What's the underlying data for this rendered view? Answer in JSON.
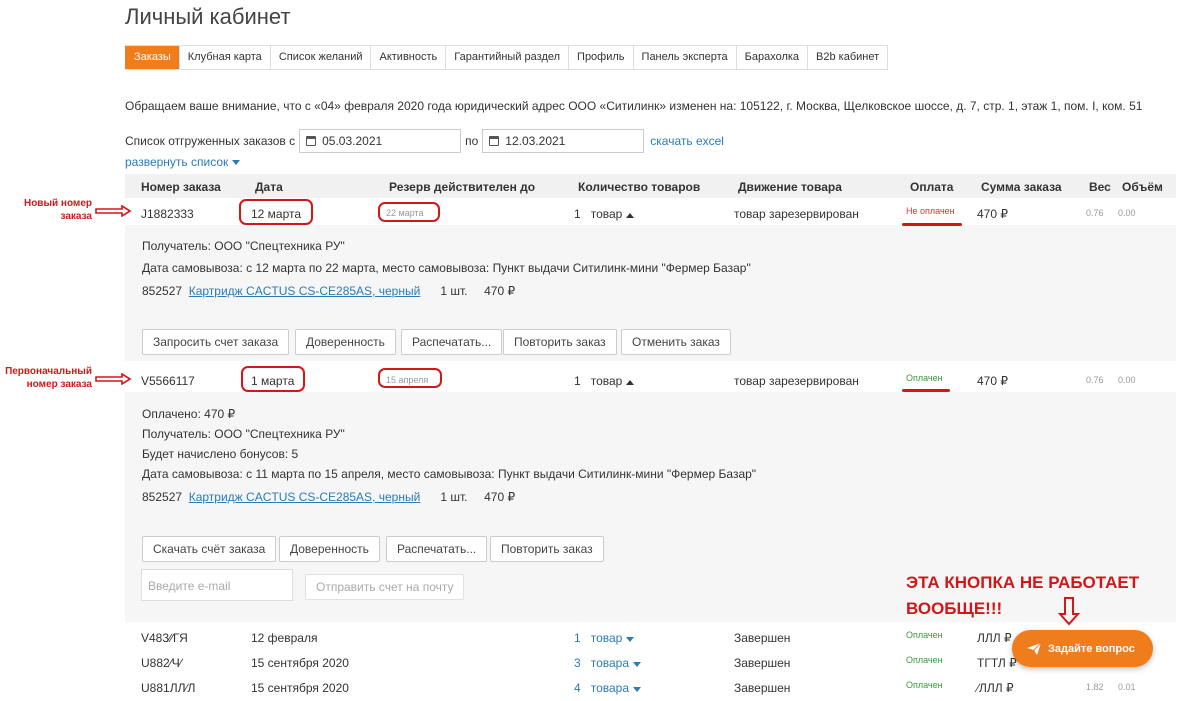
{
  "page": {
    "title": "Личный кабинет"
  },
  "tabs": [
    "Заказы",
    "Клубная карта",
    "Список желаний",
    "Активность",
    "Гарантийный раздел",
    "Профиль",
    "Панель эксперта",
    "Барахолка",
    "B2b кабинет"
  ],
  "notice": "Обращаем ваше внимание, что с «04» февраля 2020 года юридический адрес ООО «Ситилинк» изменен на: 105122, г. Москва, Щелковское шоссе, д. 7, стр. 1, этаж 1, пом. I, ком. 51",
  "filter": {
    "label": "Список отгруженных заказов с",
    "from": "05.03.2021",
    "to_label": "по",
    "to": "12.03.2021",
    "excel": "скачать excel",
    "expand": "развернуть список"
  },
  "columns": [
    "Номер заказа",
    "Дата",
    "Резерв действителен до",
    "Количество товаров",
    "Движение товара",
    "Оплата",
    "Сумма заказа",
    "Вес",
    "Объём"
  ],
  "order1": {
    "number": "J1882333",
    "date": "12 марта",
    "reserve": "22 марта",
    "qty": "1",
    "qty_unit": "товар",
    "movement": "товар зарезервирован",
    "payment": "Не оплачен",
    "sum": "470 ₽",
    "weight": "0.76",
    "volume": "0.00",
    "recipient": "Получатель: ООО \"Спецтехника РУ\"",
    "pickup": "Дата самовывоза: с 12 марта по 22 марта, место самовывоза: Пункт выдачи Ситилинк-мини \"Фермер Базар\"",
    "item_code": "852527",
    "item_name": "Картридж CACTUS CS-CE285AS, черный",
    "item_qty": "1 шт.",
    "item_price": "470 ₽",
    "buttons": [
      "Запросить счет заказа",
      "Доверенность",
      "Распечатать...",
      "Повторить заказ",
      "Отменить заказ"
    ]
  },
  "order2": {
    "number": "V5566117",
    "date": "1 марта",
    "reserve": "15 апреля",
    "qty": "1",
    "qty_unit": "товар",
    "movement": "товар зарезервирован",
    "payment": "Оплачен",
    "sum": "470 ₽",
    "weight": "0.76",
    "volume": "0.00",
    "paid": "Оплачено:  470 ₽",
    "recipient": "Получатель: ООО \"Спецтехника РУ\"",
    "bonus": "Будет начислено бонусов: 5",
    "pickup": "Дата самовывоза: с 11 марта по 15 апреля, место самовывоза: Пункт выдачи Ситилинк-мини \"Фермер Базар\"",
    "item_code": "852527",
    "item_name": "Картридж CACTUS CS-CE285AS, черный",
    "item_qty": "1 шт.",
    "item_price": "470 ₽",
    "buttons": [
      "Скачать счёт заказа",
      "Доверенность",
      "Распечатать...",
      "Повторить заказ"
    ],
    "email_placeholder": "Введите e-mail",
    "send_button": "Отправить счет на почту"
  },
  "history": [
    {
      "number": "V483∕∕ГЯ",
      "date": "12 февраля",
      "qty": "1",
      "unit": "товар",
      "movement": "Завершен",
      "payment": "Оплачен",
      "sum": "ЛЛЛ ₽"
    },
    {
      "number": "U882∕Ч∕",
      "date": "15 сентября 2020",
      "qty": "3",
      "unit": "товара",
      "movement": "Завершен",
      "payment": "Оплачен",
      "sum": "ТГТЛ ₽"
    },
    {
      "number": "U881ЛЛ∕Л",
      "date": "15 сентября 2020",
      "qty": "4",
      "unit": "товара",
      "movement": "Завершен",
      "payment": "Оплачен",
      "sum": "∕ЛЛЛ ₽",
      "weight": "1.82",
      "volume": "0.01"
    }
  ],
  "annotations": {
    "new_number": "Новый номер заказа",
    "original_number": "Первоначальный номер заказа",
    "big_note": "ЭТА КНОПКА НЕ РАБОТАЕТ ВООБЩЕ!!!"
  },
  "ask_button": "Задайте вопрос",
  "colors": {
    "accent": "#f07d1b",
    "link": "#2a7bb6",
    "annotation": "#d01818",
    "paid": "#3a9a3a"
  }
}
